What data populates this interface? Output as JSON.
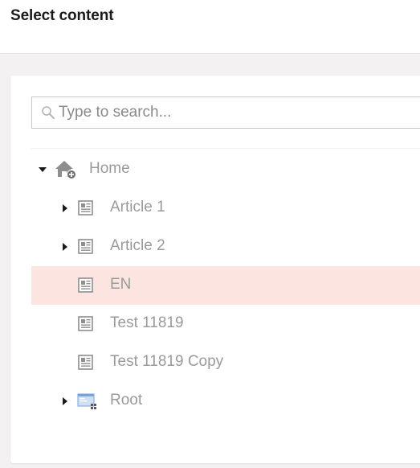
{
  "header": {
    "title": "Select content"
  },
  "search": {
    "placeholder": "Type to search...",
    "value": ""
  },
  "tree": {
    "root": {
      "label": "Home",
      "expanded": true,
      "icon": "home-add-icon"
    },
    "children": [
      {
        "label": "Article 1",
        "expandable": true,
        "icon": "article-icon"
      },
      {
        "label": "Article 2",
        "expandable": true,
        "icon": "article-icon"
      },
      {
        "label": "EN",
        "expandable": false,
        "selected": true,
        "icon": "article-icon"
      },
      {
        "label": "Test 11819",
        "expandable": false,
        "icon": "article-icon"
      },
      {
        "label": "Test 11819 Copy",
        "expandable": false,
        "icon": "article-icon"
      },
      {
        "label": "Root",
        "expandable": true,
        "icon": "root-content-icon"
      }
    ]
  },
  "colors": {
    "selected_row": "#fce5e0",
    "label_text": "#9a9a9a",
    "header_text": "#1b1b1b"
  }
}
